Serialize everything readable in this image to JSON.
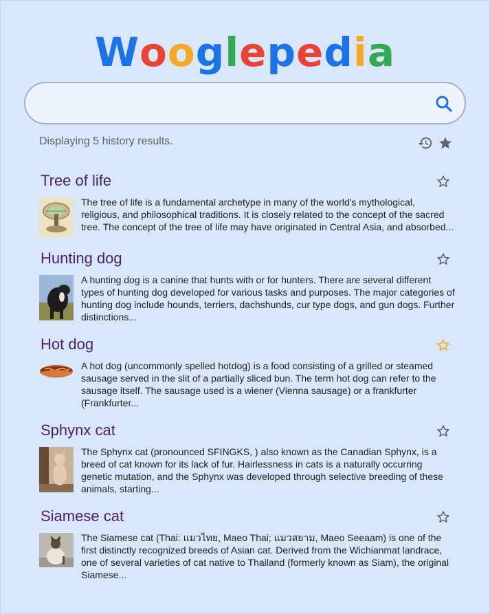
{
  "logo": {
    "letters": [
      {
        "ch": "W",
        "color": "#1a73e8"
      },
      {
        "ch": "o",
        "color": "#ea4335"
      },
      {
        "ch": "o",
        "color": "#f9a825"
      },
      {
        "ch": "g",
        "color": "#1a73e8"
      },
      {
        "ch": "l",
        "color": "#34a853"
      },
      {
        "ch": "e",
        "color": "#ea4335"
      },
      {
        "ch": "p",
        "color": "#1a73e8"
      },
      {
        "ch": "e",
        "color": "#ea4335"
      },
      {
        "ch": "d",
        "color": "#1a73e8"
      },
      {
        "ch": "i",
        "color": "#f9a825"
      },
      {
        "ch": "a",
        "color": "#34a853"
      }
    ]
  },
  "search": {
    "value": "",
    "placeholder": "",
    "icon": "search-icon"
  },
  "status_text": "Displaying 5 history results.",
  "toolbar": {
    "history_icon": "history-icon",
    "favorites_icon": "star-filled-icon"
  },
  "colors": {
    "title": "#4a1f73",
    "star_outline": "#5f6368",
    "star_active": "#f9a825"
  },
  "results": [
    {
      "title": "Tree of life",
      "favorite_highlighted": false,
      "snippet": "The tree of life is a fundamental archetype in many of the world's mythological, religious, and philosophical traditions. It is closely related to the concept of the sacred tree. The concept of the tree of life may have originated in Central Asia, and absorbed..."
    },
    {
      "title": "Hunting dog",
      "favorite_highlighted": false,
      "snippet": "A hunting dog is a canine that hunts with or for hunters. There are several different types of hunting dog developed for various tasks and purposes. The major categories of hunting dog include hounds, terriers, dachshunds, cur type dogs, and gun dogs. Further distinctions..."
    },
    {
      "title": "Hot dog",
      "favorite_highlighted": true,
      "snippet": "A hot dog (uncommonly spelled hotdog) is a food consisting of a grilled or steamed sausage served in the slit of a partially sliced bun. The term hot dog can refer to the sausage itself. The sausage used is a wiener (Vienna sausage) or a frankfurter (Frankfurter..."
    },
    {
      "title": "Sphynx cat",
      "favorite_highlighted": false,
      "snippet": "The Sphynx cat (pronounced SFINGKS, ) also known as the Canadian Sphynx, is a breed of cat known for its lack of fur. Hairlessness in cats is a naturally occurring genetic mutation, and the Sphynx was developed through selective breeding of these animals, starting..."
    },
    {
      "title": "Siamese cat",
      "favorite_highlighted": false,
      "snippet": "The Siamese cat (Thai: แมวไทย, Maeo Thai; แมวสยาม, Maeo Seeaam) is one of the first distinctly recognized breeds of Asian cat. Derived from the Wichianmat landrace, one of several varieties of cat native to Thailand (formerly known as Siam), the original Siamese..."
    }
  ]
}
